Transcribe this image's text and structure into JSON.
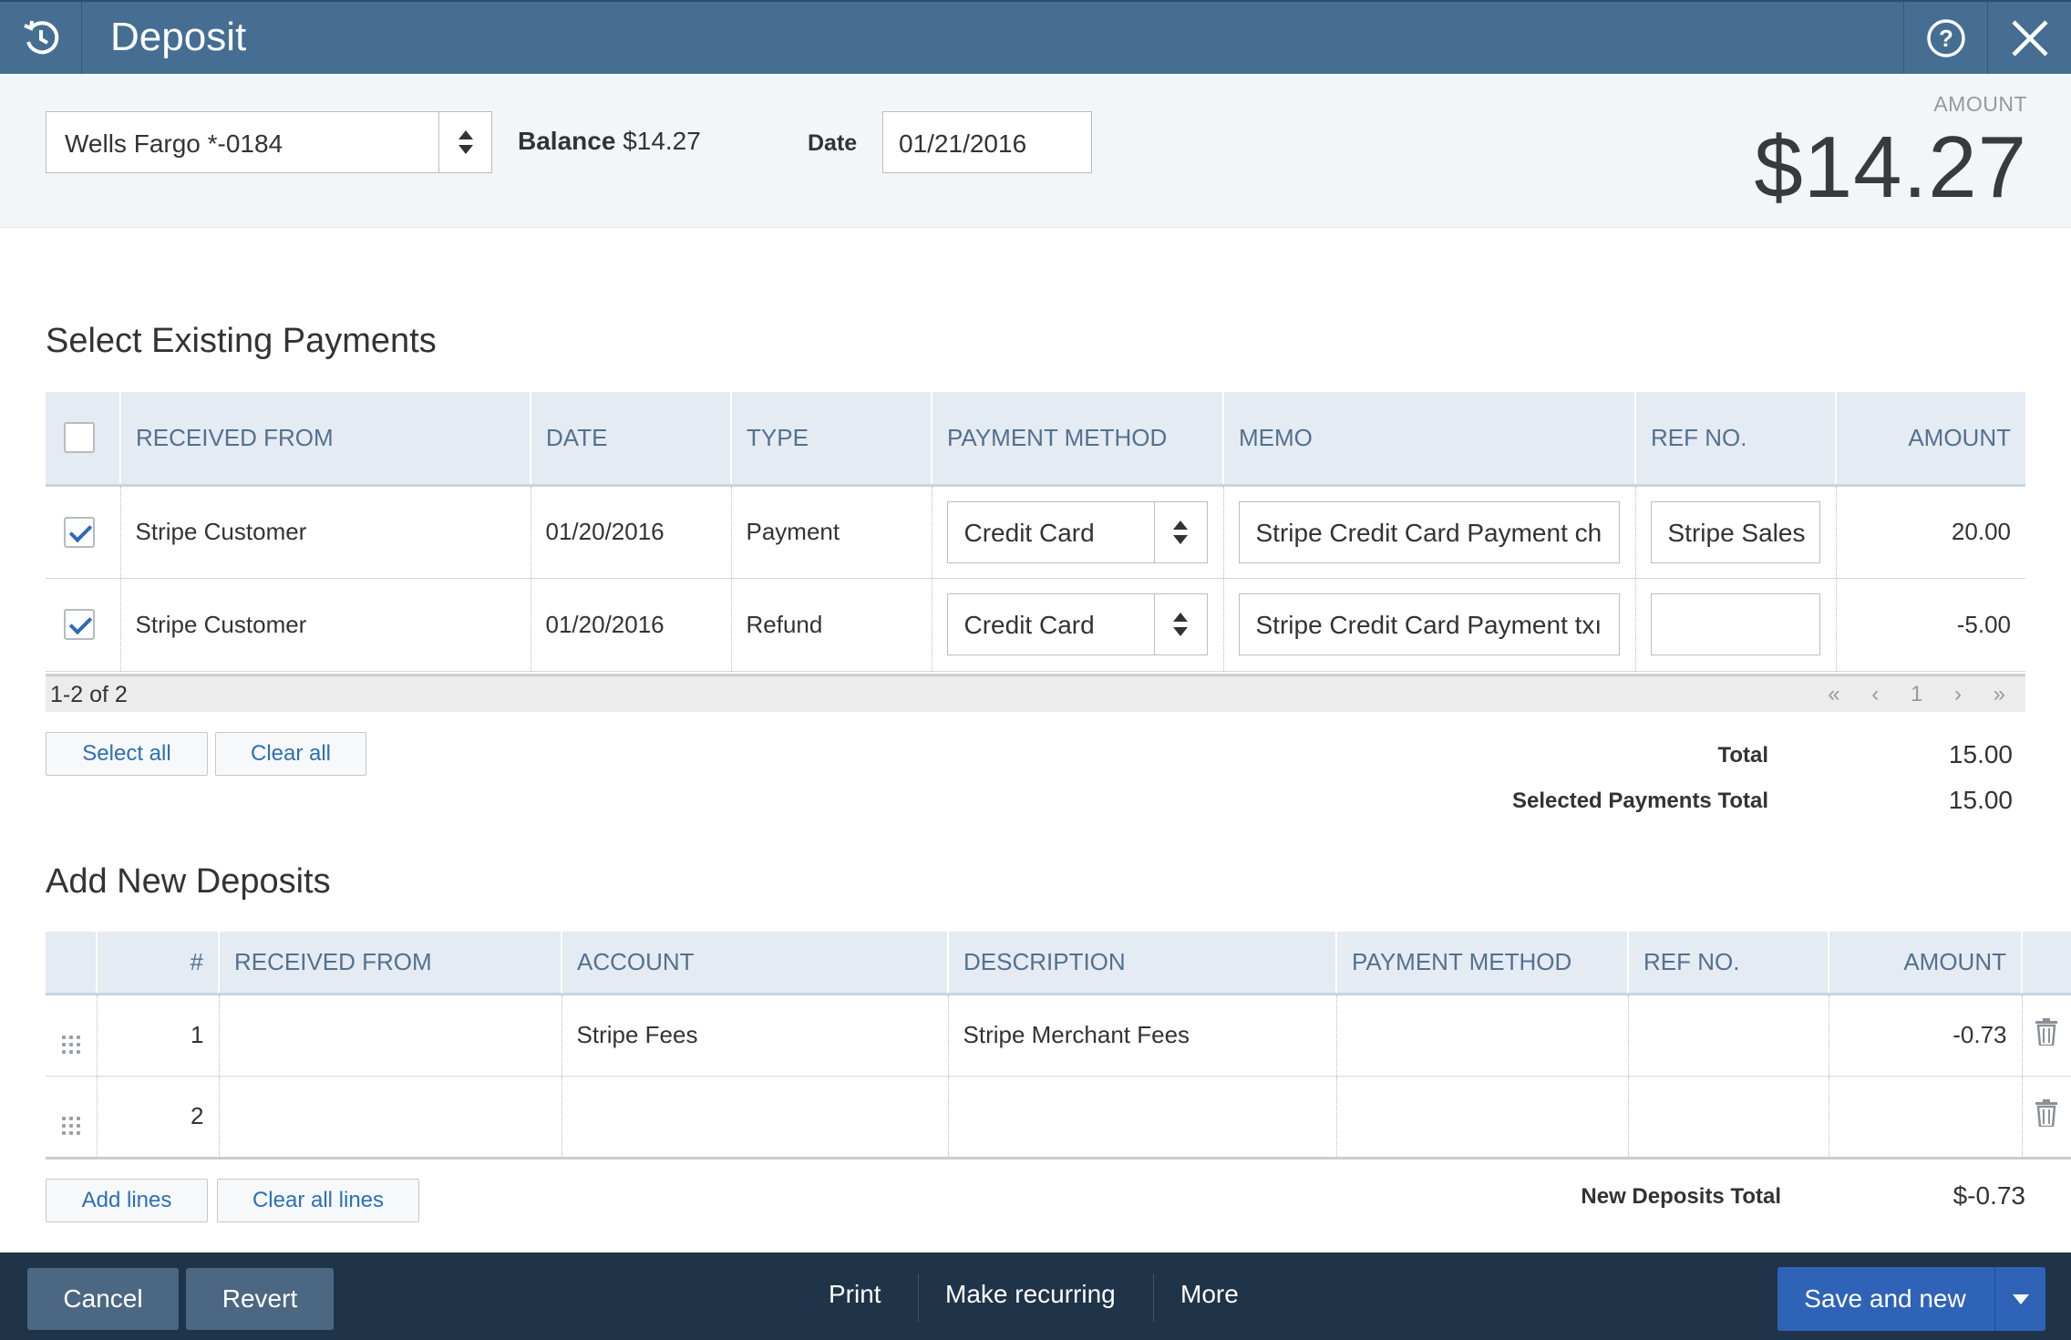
{
  "window": {
    "title": "Deposit",
    "history_icon": "history-clock-icon",
    "help_icon": "help-circle-icon",
    "close_icon": "close-icon"
  },
  "header": {
    "account_value": "Wells Fargo *-0184",
    "balance_label": "Balance",
    "balance_value": "$14.27",
    "date_label": "Date",
    "date_value": "01/21/2016",
    "amount_label": "AMOUNT",
    "amount_value": "$14.27"
  },
  "existing": {
    "title": "Select Existing Payments",
    "columns": {
      "received_from": "RECEIVED FROM",
      "date": "DATE",
      "type": "TYPE",
      "payment_method": "PAYMENT METHOD",
      "memo": "MEMO",
      "ref_no": "REF NO.",
      "amount": "AMOUNT"
    },
    "rows": [
      {
        "checked": true,
        "received_from": "Stripe Customer",
        "date": "01/20/2016",
        "type": "Payment",
        "payment_method": "Credit Card",
        "memo": "Stripe Credit Card Payment ch",
        "ref_no": "Stripe Sales",
        "amount": "20.00"
      },
      {
        "checked": true,
        "received_from": "Stripe Customer",
        "date": "01/20/2016",
        "type": "Refund",
        "payment_method": "Credit Card",
        "memo": "Stripe Credit Card Payment txı",
        "ref_no": "",
        "amount": "-5.00"
      }
    ],
    "pager_count": "1-2 of 2",
    "pager_first": "«",
    "pager_prev": "‹",
    "pager_page": "1",
    "pager_next": "›",
    "pager_last": "»",
    "select_all": "Select all",
    "clear_all": "Clear all",
    "total_label": "Total",
    "total_value": "15.00",
    "selected_total_label": "Selected Payments Total",
    "selected_total_value": "15.00"
  },
  "new_deposits": {
    "title": "Add New Deposits",
    "columns": {
      "num": "#",
      "received_from": "RECEIVED FROM",
      "account": "ACCOUNT",
      "description": "DESCRIPTION",
      "payment_method": "PAYMENT METHOD",
      "ref_no": "REF NO.",
      "amount": "AMOUNT"
    },
    "rows": [
      {
        "num": "1",
        "received_from": "",
        "account": "Stripe Fees",
        "description": "Stripe Merchant Fees",
        "payment_method": "",
        "ref_no": "",
        "amount": "-0.73"
      },
      {
        "num": "2",
        "received_from": "",
        "account": "",
        "description": "",
        "payment_method": "",
        "ref_no": "",
        "amount": ""
      }
    ],
    "add_lines": "Add lines",
    "clear_all_lines": "Clear all lines",
    "total_label": "New Deposits Total",
    "total_value": "$-0.73"
  },
  "footer": {
    "cancel": "Cancel",
    "revert": "Revert",
    "print": "Print",
    "make_recurring": "Make recurring",
    "more": "More",
    "save_and_new": "Save and new"
  },
  "colors": {
    "titlebar": "#456e92",
    "footer": "#1f3349",
    "primary_button": "#2e63b8",
    "link": "#2b6fb8",
    "table_header": "#e4ebf3"
  }
}
